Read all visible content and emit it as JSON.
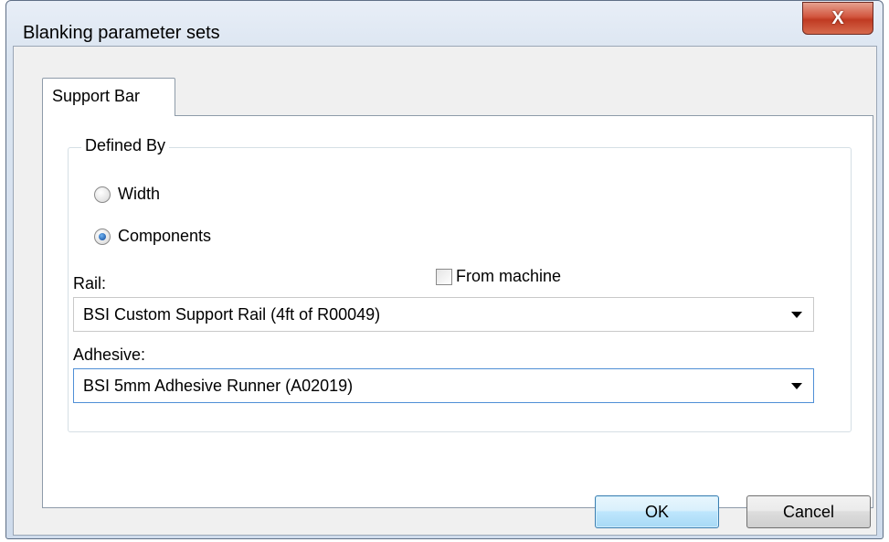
{
  "window": {
    "title": "Blanking parameter sets",
    "close_label": "X"
  },
  "tabs": [
    {
      "label": "Support Bar",
      "selected": true
    }
  ],
  "defined_by": {
    "group_label": "Defined By",
    "options": [
      {
        "label": "Width",
        "checked": false
      },
      {
        "label": "Components",
        "checked": true
      }
    ]
  },
  "rail": {
    "label": "Rail:",
    "from_machine_label": "From machine",
    "from_machine_checked": false,
    "selected": "BSI Custom Support Rail (4ft of R00049)"
  },
  "adhesive": {
    "label": "Adhesive:",
    "selected": "BSI 5mm Adhesive Runner (A02019)"
  },
  "buttons": {
    "ok_label": "OK",
    "cancel_label": "Cancel"
  },
  "icons": {
    "close": "close-icon",
    "dropdown": "chevron-down-icon"
  }
}
